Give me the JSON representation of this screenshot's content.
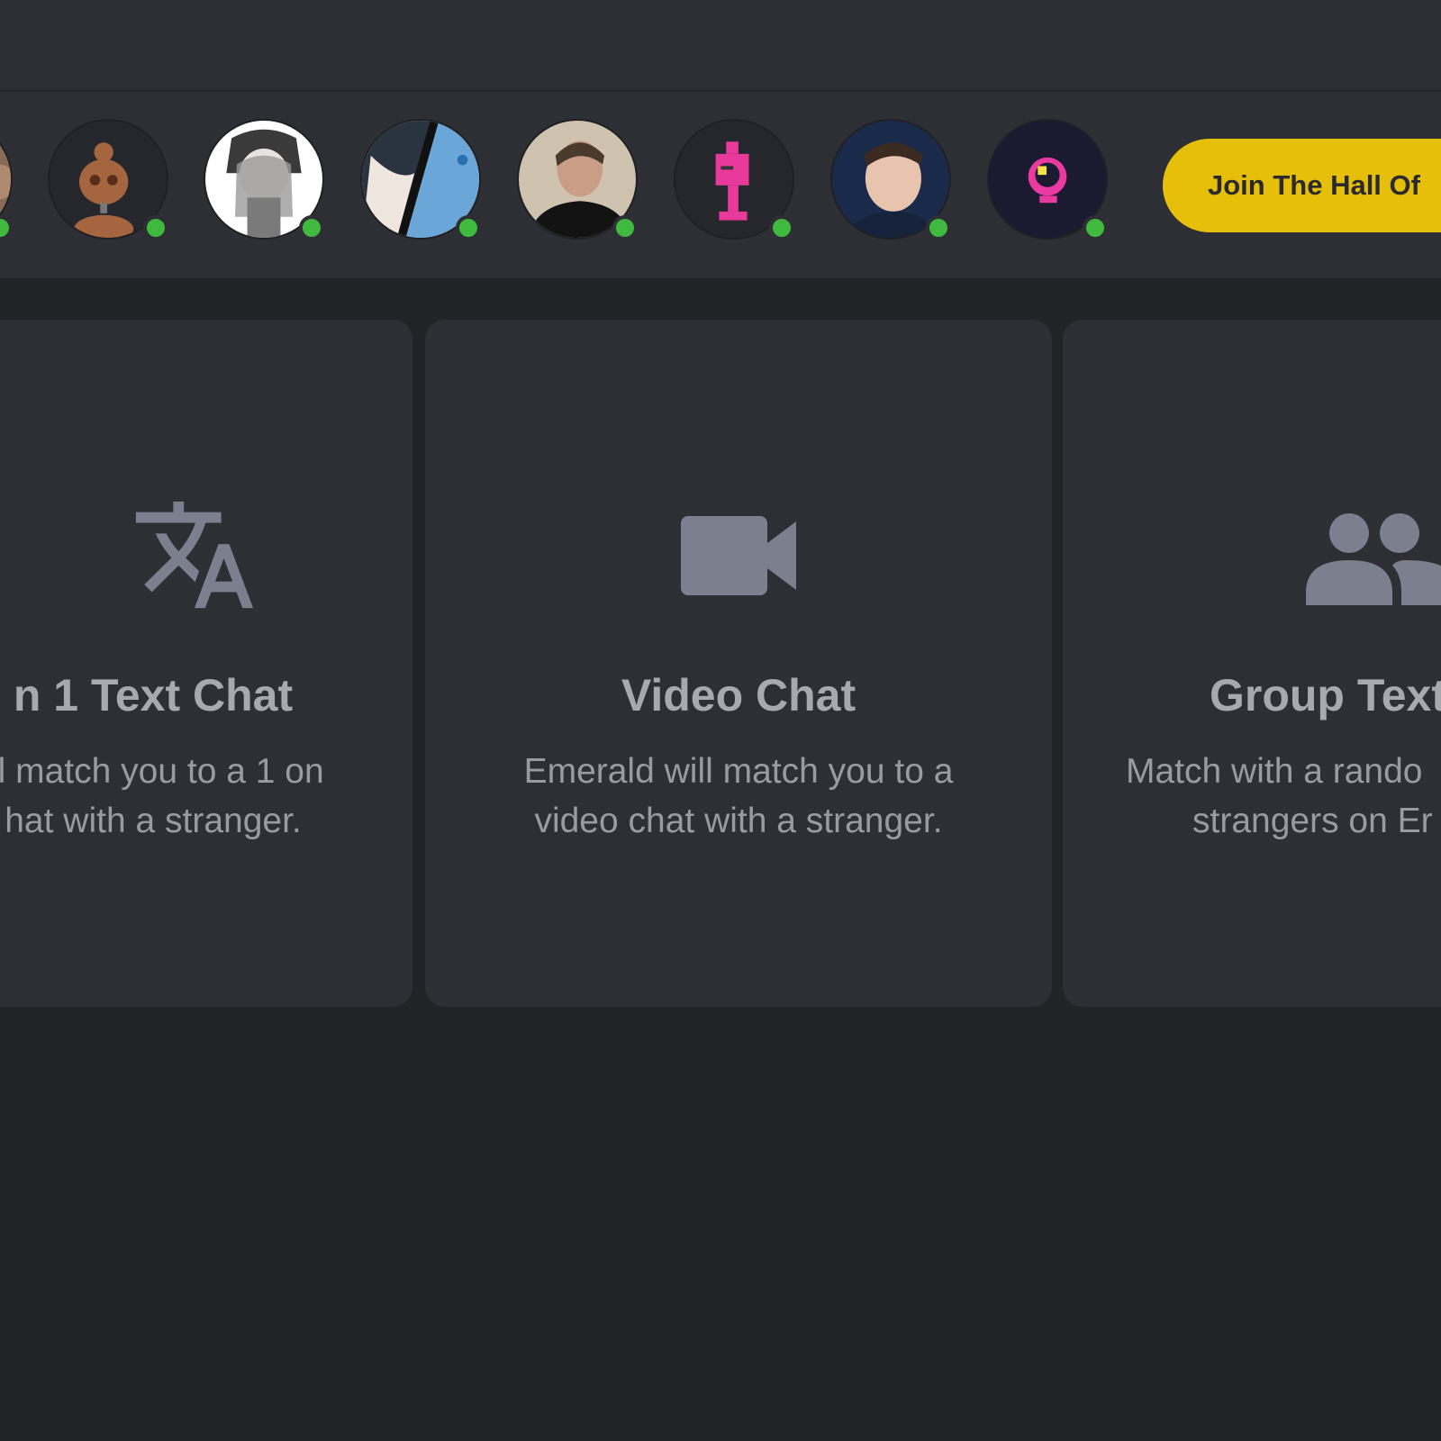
{
  "avatars": [
    {
      "name": "user-avatar-1",
      "online": true
    },
    {
      "name": "user-avatar-2",
      "online": true
    },
    {
      "name": "user-avatar-3",
      "online": true
    },
    {
      "name": "user-avatar-4",
      "online": true
    },
    {
      "name": "user-avatar-5",
      "online": true
    },
    {
      "name": "user-avatar-6",
      "online": true
    },
    {
      "name": "user-avatar-7",
      "online": true
    },
    {
      "name": "user-avatar-8",
      "online": true
    },
    {
      "name": "user-avatar-9",
      "online": true
    }
  ],
  "hall_button": {
    "label": "Join The Hall Of"
  },
  "cards": [
    {
      "icon": "translate-icon",
      "title": "n 1 Text Chat",
      "desc_line1": "ill match you to a 1 on",
      "desc_line2": "hat with a stranger."
    },
    {
      "icon": "video-camera-icon",
      "title": "Video Chat",
      "desc_line1": "Emerald will match you to a",
      "desc_line2": "video chat with a stranger."
    },
    {
      "icon": "group-icon",
      "title": "Group Text",
      "desc_line1": "Match with a rando",
      "desc_line2": "strangers on Er"
    }
  ],
  "colors": {
    "background": "#222327",
    "panel": "#2e2f35",
    "accent_yellow": "#e6bf0b",
    "online_green": "#3fba3f",
    "icon_gray": "#7b7f8e"
  }
}
